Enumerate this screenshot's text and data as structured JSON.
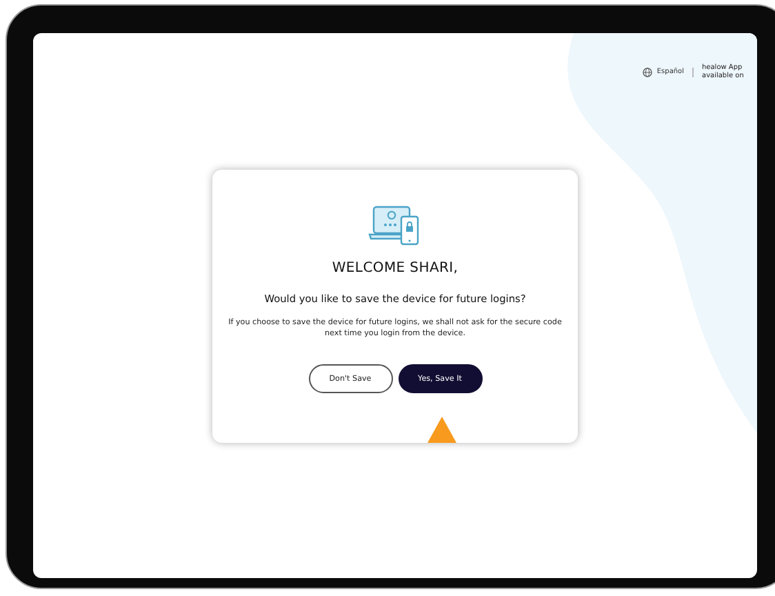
{
  "header": {
    "language_link": "Español",
    "app_promo": "healow App available on"
  },
  "dialog": {
    "title": "WELCOME SHARI,",
    "question": "Would you like to save the device for future logins?",
    "message": "If you choose to save the device for future logins, we shall not ask for the secure code next time you login from the device.",
    "buttons": [
      {
        "label": "Don't Save",
        "kind": "secondary"
      },
      {
        "label": "Yes, Save It",
        "kind": "primary"
      }
    ]
  }
}
